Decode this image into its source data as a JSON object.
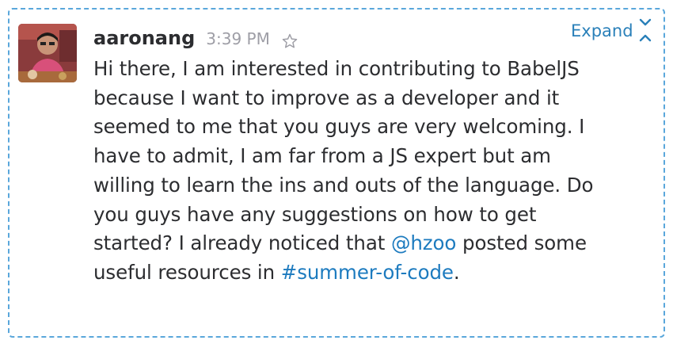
{
  "message": {
    "author": "aaronang",
    "time": "3:39 PM",
    "expand_label": "Expand",
    "lines": [
      "Hi there, I am interested in contributing to BabelJS",
      "because I want to improve as a developer and it",
      "seemed to me that you guys are very welcoming. I",
      "have to admit, I am far from a JS expert but am",
      "willing to learn the ins and outs of the language. Do",
      "you guys have any suggestions on how to get"
    ],
    "line7_before": "started? I already noticed that ",
    "mention": "@hzoo",
    "line7_after": " posted some",
    "line8_before": "useful resources in ",
    "channel": "#summer-of-code",
    "line8_after": "."
  },
  "colors": {
    "accent": "#2a80b9",
    "border": "#5aa7db",
    "text": "#2c2d30",
    "muted": "#9e9ea6"
  },
  "icons": {
    "star": "star-outline-icon",
    "expand": "chevrons-icon"
  }
}
